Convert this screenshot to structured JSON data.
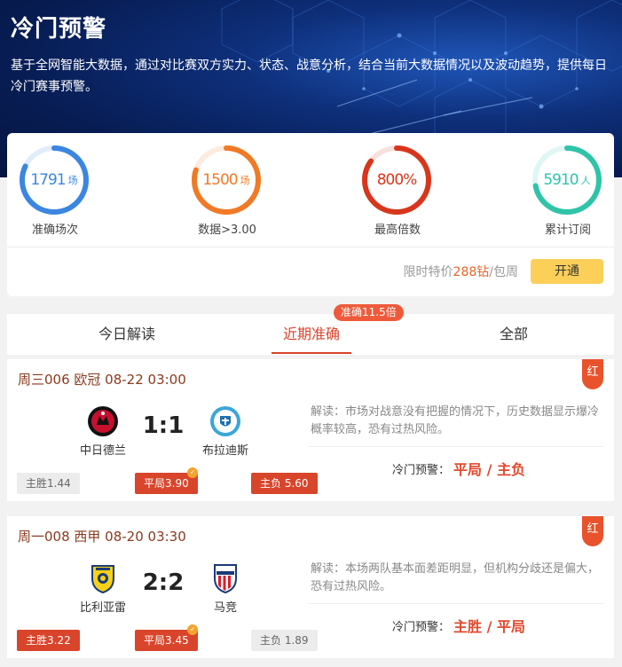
{
  "header": {
    "title": "冷门预警",
    "description": "基于全网智能大数据，通过对比赛双方实力、状态、战意分析，结合当前大数据情况以及波动趋势，提供每日冷门赛事预警。"
  },
  "stats": [
    {
      "value": "1791",
      "unit": "场",
      "label": "准确场次",
      "color": "#3b86e0",
      "progress": 0.82
    },
    {
      "value": "1500",
      "unit": "场",
      "label": "数据>3.00",
      "color": "#f07a25",
      "progress": 0.8
    },
    {
      "value": "800%",
      "unit": "",
      "label": "最高倍数",
      "color": "#d8361c",
      "progress": 0.85
    },
    {
      "value": "5910",
      "unit": "人",
      "label": "累计订阅",
      "color": "#2fc4a9",
      "progress": 0.72
    }
  ],
  "subscribe": {
    "price_prefix": "限时特价",
    "price_value": "288钻",
    "price_suffix": "/包周",
    "button": "开通"
  },
  "tabs": {
    "badge": "准确11.5倍",
    "items": [
      "今日解读",
      "近期准确",
      "全部"
    ],
    "active_index": 1
  },
  "matches": [
    {
      "header": "周三006 欧冠 08-22 03:00",
      "tag": "红",
      "home": {
        "name": "中日德兰",
        "logo": "midtjylland-logo-icon"
      },
      "away": {
        "name": "布拉迪斯",
        "logo": "slovan-logo-icon"
      },
      "score": "1:1",
      "odds": {
        "home": "主胜1.44",
        "draw": "平局3.90",
        "away": "主负 5.60"
      },
      "analysis": "解读：市场对战意没有把握的情况下，历史数据显示爆冷概率较高，恐有过热风险。",
      "warning_label": "冷门预警：",
      "warning_value": "平局 / 主负"
    },
    {
      "header": "周一008 西甲 08-20 03:30",
      "tag": "红",
      "home": {
        "name": "比利亚雷",
        "logo": "villarreal-logo-icon"
      },
      "away": {
        "name": "马竞",
        "logo": "atletico-logo-icon"
      },
      "score": "2:2",
      "odds": {
        "home": "主胜3.22",
        "draw": "平局3.45",
        "away": "主负 1.89"
      },
      "analysis": "解读：本场两队基本面差距明显，但机构分歧还是偏大，恐有过热风险。",
      "warning_label": "冷门预警：",
      "warning_value": "主胜 / 平局"
    }
  ]
}
